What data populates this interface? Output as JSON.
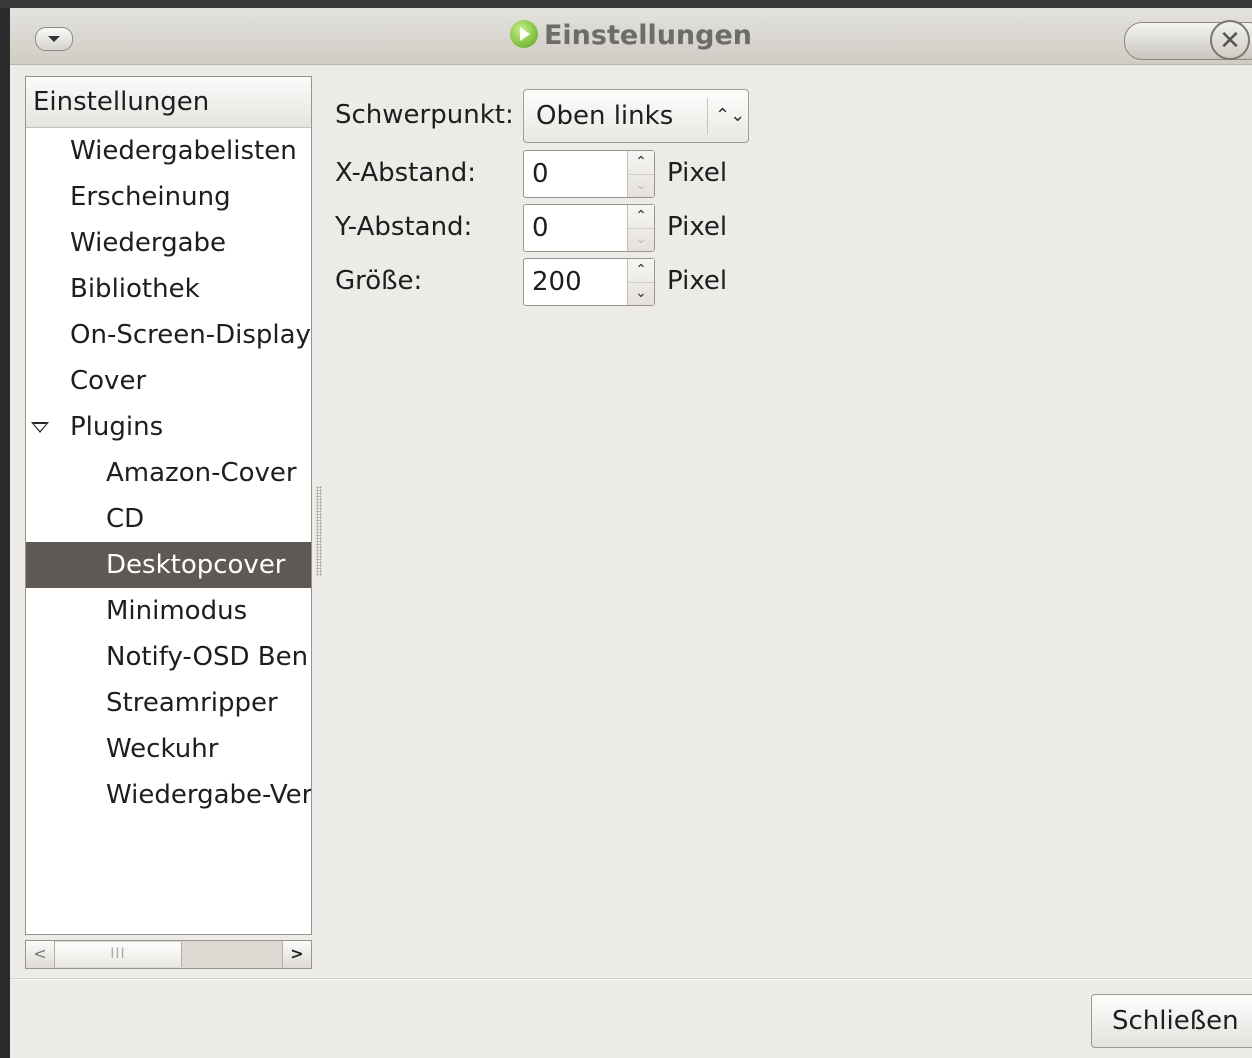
{
  "window": {
    "title": "Einstellungen",
    "close_symbol": "✕"
  },
  "sidebar": {
    "header": "Einstellungen",
    "items": [
      {
        "label": "Wiedergabelisten",
        "level": 0
      },
      {
        "label": "Erscheinung",
        "level": 0
      },
      {
        "label": "Wiedergabe",
        "level": 0
      },
      {
        "label": "Bibliothek",
        "level": 0
      },
      {
        "label": "On-Screen-Display",
        "level": 0
      },
      {
        "label": "Cover",
        "level": 0
      },
      {
        "label": "Plugins",
        "level": 0,
        "expanded": true
      },
      {
        "label": "Amazon-Cover",
        "level": 1
      },
      {
        "label": "CD",
        "level": 1
      },
      {
        "label": "Desktopcover",
        "level": 1,
        "selected": true
      },
      {
        "label": "Minimodus",
        "level": 1
      },
      {
        "label": "Notify-OSD Ben",
        "level": 1
      },
      {
        "label": "Streamripper",
        "level": 1
      },
      {
        "label": "Weckuhr",
        "level": 1
      },
      {
        "label": "Wiedergabe-Ver",
        "level": 1
      }
    ],
    "hscroll": {
      "left_arrow": "<",
      "right_arrow": ">",
      "thumb_grip": "III"
    }
  },
  "form": {
    "gravity": {
      "label": "Schwerpunkt:",
      "value": "Oben links",
      "arrow": "⌃⌄"
    },
    "x_offset": {
      "label": "X-Abstand:",
      "value": "0",
      "unit": "Pixel"
    },
    "y_offset": {
      "label": "Y-Abstand:",
      "value": "0",
      "unit": "Pixel"
    },
    "size": {
      "label": "Größe:",
      "value": "200",
      "unit": "Pixel"
    },
    "spin_up": "⌃",
    "spin_down": "⌄"
  },
  "footer": {
    "close_label": "Schließen"
  }
}
